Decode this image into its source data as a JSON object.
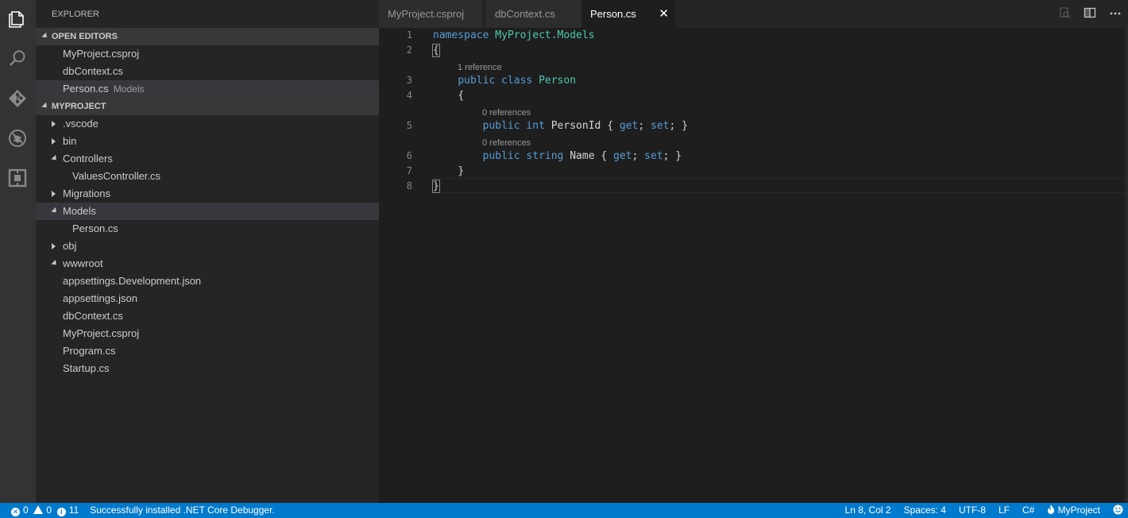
{
  "activity_bar": {
    "items": [
      {
        "name": "explorer-icon"
      },
      {
        "name": "search-icon"
      },
      {
        "name": "git-icon"
      },
      {
        "name": "debug-icon"
      },
      {
        "name": "extensions-icon"
      }
    ]
  },
  "sidebar": {
    "title": "EXPLORER",
    "open_editors_header": "OPEN EDITORS",
    "open_editors": [
      {
        "label": "MyProject.csproj",
        "desc": ""
      },
      {
        "label": "dbContext.cs",
        "desc": ""
      },
      {
        "label": "Person.cs",
        "desc": "Models"
      }
    ],
    "project_header": "MYPROJECT",
    "tree": [
      {
        "label": ".vscode"
      },
      {
        "label": "bin"
      },
      {
        "label": "Controllers"
      },
      {
        "label": "ValuesController.cs"
      },
      {
        "label": "Migrations"
      },
      {
        "label": "Models"
      },
      {
        "label": "Person.cs"
      },
      {
        "label": "obj"
      },
      {
        "label": "wwwroot"
      },
      {
        "label": "appsettings.Development.json"
      },
      {
        "label": "appsettings.json"
      },
      {
        "label": "dbContext.cs"
      },
      {
        "label": "MyProject.csproj"
      },
      {
        "label": "Program.cs"
      },
      {
        "label": "Startup.cs"
      }
    ]
  },
  "editor": {
    "tabs": [
      {
        "label": "MyProject.csproj"
      },
      {
        "label": "dbContext.cs"
      },
      {
        "label": "Person.cs",
        "close": "✕"
      }
    ],
    "code": {
      "line_numbers": [
        "1",
        "2",
        "3",
        "4",
        "5",
        "6",
        "7",
        "8"
      ],
      "lens": [
        "1 reference",
        "0 references",
        "0 references"
      ],
      "tokens": {
        "namespace": "namespace",
        "ns_name": "MyProject.Models",
        "open_brace": "{",
        "public": "public",
        "class": "class",
        "class_name": "Person",
        "int": "int",
        "prop_id": "PersonId",
        "string": "string",
        "prop_name": "Name",
        "lbrace": "{",
        "get": "get",
        "set": "set",
        "semi": ";",
        "rbrace": "}",
        "close_brace": "}"
      }
    }
  },
  "status_bar": {
    "errors": "0",
    "warnings": "0",
    "infos": "11",
    "message": "Successfully installed .NET Core Debugger.",
    "position": "Ln 8, Col 2",
    "spaces": "Spaces: 4",
    "encoding": "UTF-8",
    "eol": "LF",
    "language": "C#",
    "project": "MyProject"
  },
  "colors": {
    "accent": "#007acc",
    "keyword": "#569cd6",
    "type": "#4ec9b0"
  }
}
